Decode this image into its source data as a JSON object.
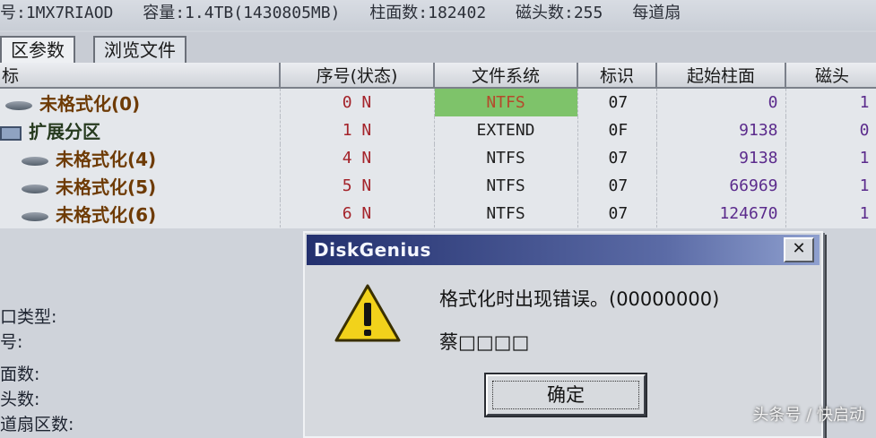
{
  "disk_info": {
    "model": "号:1MX7RIAOD",
    "capacity": "容量:1.4TB(1430805MB)",
    "cylinders": "柱面数:182402",
    "heads": "磁头数:255",
    "sectors": "每道扇"
  },
  "tabs": [
    {
      "label": "区参数"
    },
    {
      "label": "浏览文件"
    }
  ],
  "table": {
    "columns": [
      "标",
      "序号(状态)",
      "文件系统",
      "标识",
      "起始柱面",
      "磁头"
    ],
    "rows": [
      {
        "name": "未格式化(0)",
        "seq": "0 N",
        "fs": "NTFS",
        "id": "07",
        "cyl": "0",
        "head": "1"
      },
      {
        "name": "扩展分区",
        "seq": "1 N",
        "fs": "EXTEND",
        "id": "0F",
        "cyl": "9138",
        "head": "0"
      },
      {
        "name": "未格式化(4)",
        "seq": "4 N",
        "fs": "NTFS",
        "id": "07",
        "cyl": "9138",
        "head": "1"
      },
      {
        "name": "未格式化(5)",
        "seq": "5 N",
        "fs": "NTFS",
        "id": "07",
        "cyl": "66969",
        "head": "1"
      },
      {
        "name": "未格式化(6)",
        "seq": "6 N",
        "fs": "NTFS",
        "id": "07",
        "cyl": "124670",
        "head": "1"
      }
    ]
  },
  "props": {
    "type_label": "口类型:",
    "num_label": "号:",
    "faces_label": "面数:",
    "head_label": "头数:",
    "sector_label": "道扇区数:"
  },
  "dialog": {
    "title": "DiskGenius",
    "close_glyph": "✕",
    "message": "格式化时出现错误。(00000000)",
    "detail": "蔡□□□□",
    "ok_label": "确定",
    "icon": "warning-icon"
  },
  "watermark": "头条号 / 快启动",
  "colors": {
    "title_bar": "#23306e",
    "highlight_fs": "#7ec36a"
  }
}
